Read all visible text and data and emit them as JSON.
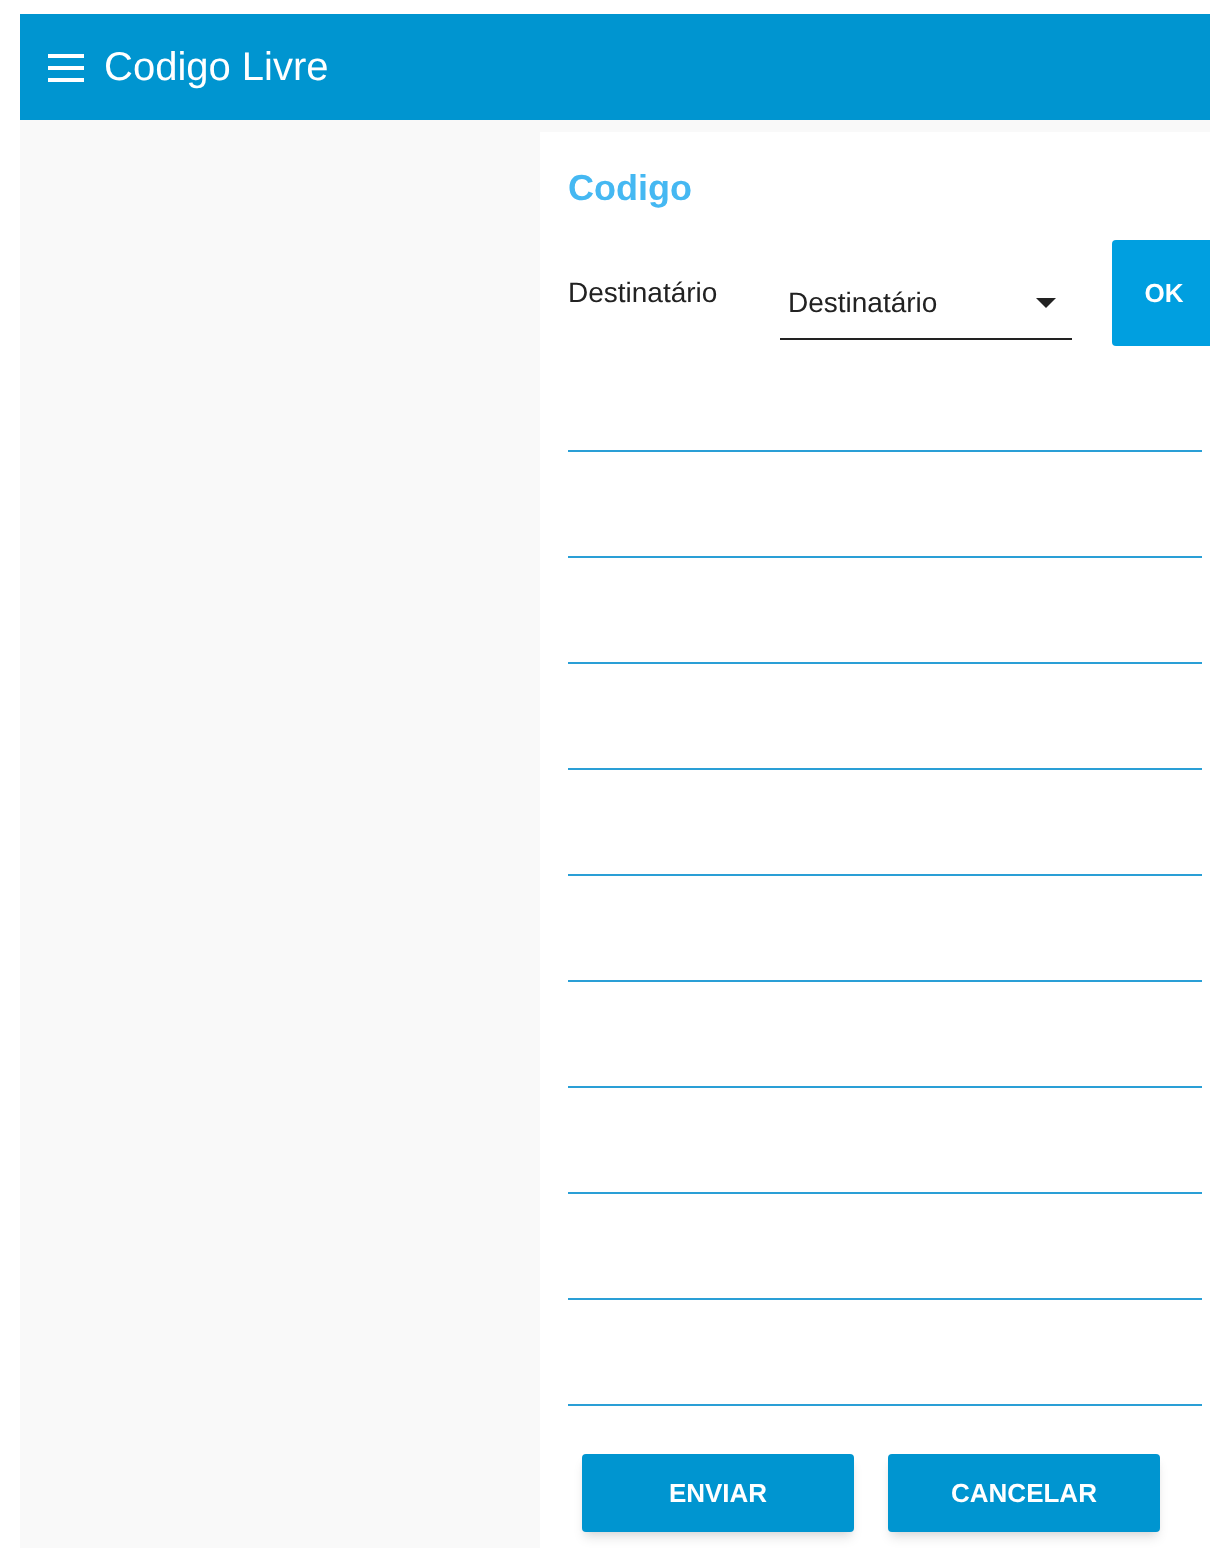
{
  "app_bar": {
    "title": "Codigo Livre"
  },
  "form": {
    "title": "Codigo",
    "recipient": {
      "label": "Destinatário",
      "value": "Destinatário"
    },
    "ok_button": "OK",
    "message_lines": [
      {
        "kind": "line"
      },
      {
        "kind": "line"
      },
      {
        "kind": "line"
      },
      {
        "kind": "line"
      },
      {
        "kind": "line"
      },
      {
        "kind": "line"
      },
      {
        "kind": "line"
      },
      {
        "kind": "line"
      },
      {
        "kind": "line"
      },
      {
        "kind": "line"
      }
    ],
    "buttons": [
      "ENVIAR",
      "CANCELAR"
    ]
  }
}
